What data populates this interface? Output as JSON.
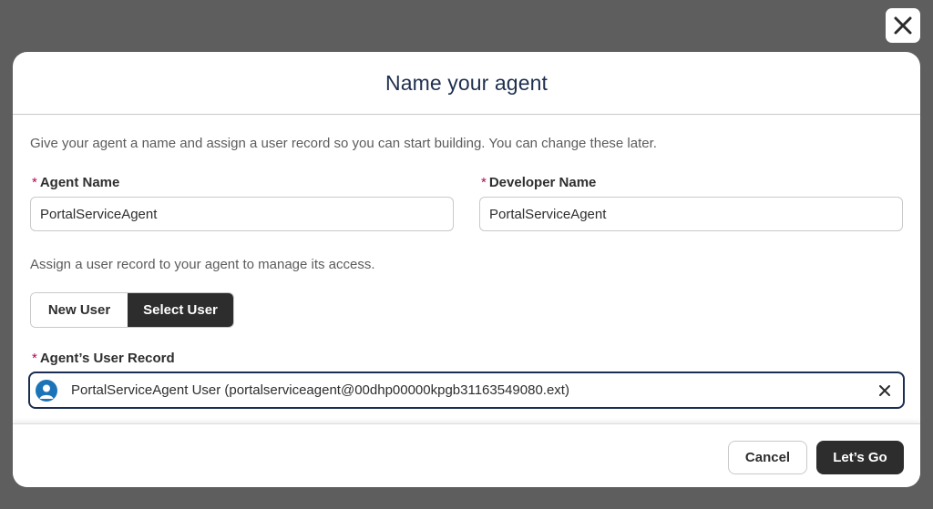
{
  "dialog": {
    "title": "Name your agent",
    "intro": "Give your agent a name and assign a user record so you can start building. You can change these later.",
    "close_icon": "close-icon"
  },
  "agent_name": {
    "required_marker": "*",
    "label": "Agent Name",
    "value": "PortalServiceAgent"
  },
  "developer_name": {
    "required_marker": "*",
    "label": "Developer Name",
    "value": "PortalServiceAgent"
  },
  "assign_text": "Assign a user record to your agent to manage its access.",
  "user_toggle": {
    "options": [
      "New User",
      "Select User"
    ],
    "selected": "Select User"
  },
  "user_record": {
    "required_marker": "*",
    "label": "Agent’s User Record",
    "value": "PortalServiceAgent User (portalserviceagent@00dhp00000kpgb31163549080.ext)",
    "icon": "user-avatar-icon",
    "clear_icon": "clear-icon"
  },
  "footer": {
    "cancel_label": "Cancel",
    "go_label": "Let’s Go"
  },
  "colors": {
    "backdrop": "#5e5e5e",
    "title": "#1f2f4f",
    "required": "#b60554",
    "primary_button": "#2d2d2d",
    "lookup_border": "#1b2d52",
    "avatar": "#1b74b8"
  }
}
